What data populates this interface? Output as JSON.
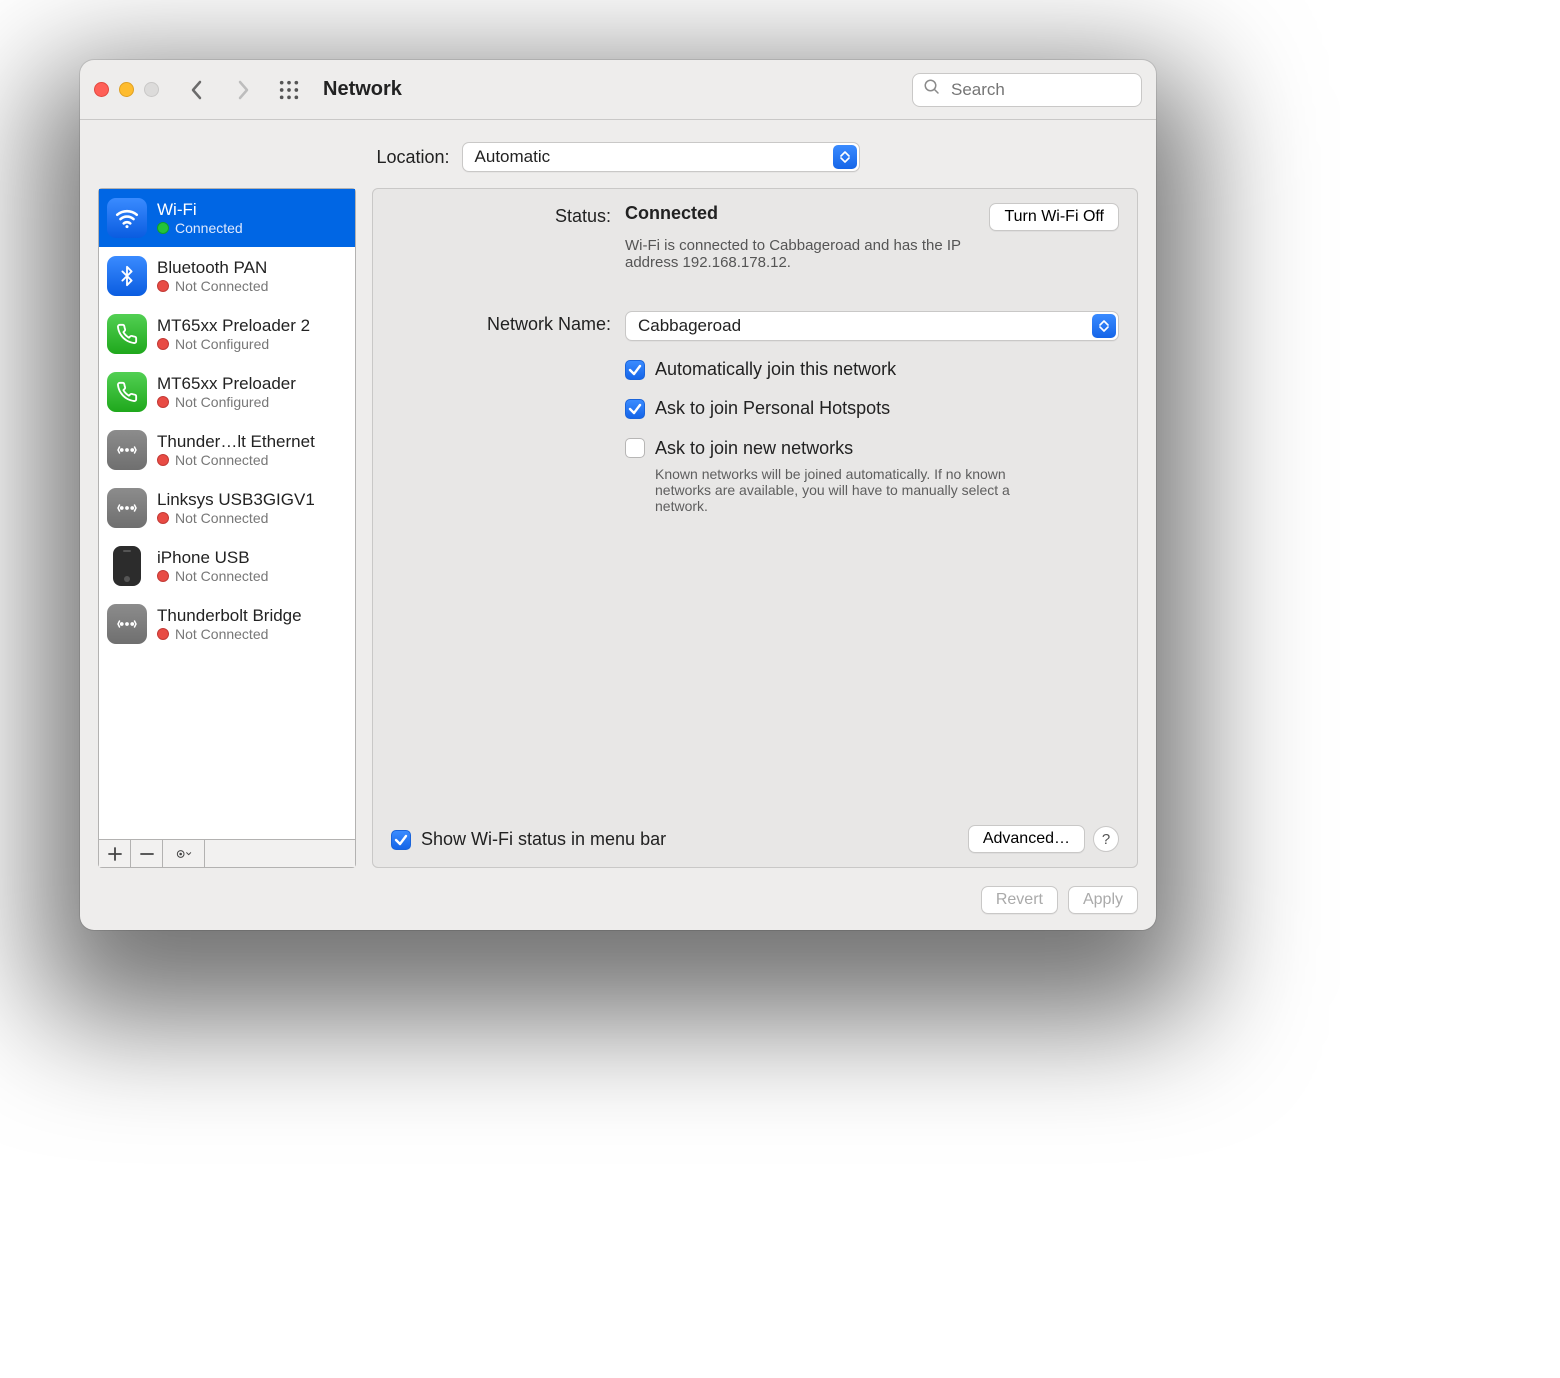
{
  "window": {
    "title": "Network"
  },
  "search": {
    "placeholder": "Search"
  },
  "location": {
    "label": "Location:",
    "value": "Automatic"
  },
  "sidebar": {
    "items": [
      {
        "name": "Wi-Fi",
        "status": "Connected",
        "statusColor": "green",
        "iconType": "wifi",
        "selected": true
      },
      {
        "name": "Bluetooth PAN",
        "status": "Not Connected",
        "statusColor": "red",
        "iconType": "bt"
      },
      {
        "name": "MT65xx Preloader 2",
        "status": "Not Configured",
        "statusColor": "red",
        "iconType": "phone"
      },
      {
        "name": "MT65xx Preloader",
        "status": "Not Configured",
        "statusColor": "red",
        "iconType": "phone"
      },
      {
        "name": "Thunder…lt Ethernet",
        "status": "Not Connected",
        "statusColor": "red",
        "iconType": "eth"
      },
      {
        "name": "Linksys USB3GIGV1",
        "status": "Not Connected",
        "statusColor": "red",
        "iconType": "eth"
      },
      {
        "name": "iPhone USB",
        "status": "Not Connected",
        "statusColor": "red",
        "iconType": "iphone"
      },
      {
        "name": "Thunderbolt Bridge",
        "status": "Not Connected",
        "statusColor": "red",
        "iconType": "eth"
      }
    ]
  },
  "detail": {
    "statusLabel": "Status:",
    "statusValue": "Connected",
    "toggleButton": "Turn Wi-Fi Off",
    "statusDetail": "Wi-Fi is connected to Cabbageroad and has the IP address 192.168.178.12.",
    "networkNameLabel": "Network Name:",
    "networkName": "Cabbageroad",
    "checks": {
      "autojoin": {
        "label": "Automatically join this network",
        "checked": true
      },
      "hotspots": {
        "label": "Ask to join Personal Hotspots",
        "checked": true
      },
      "asknew": {
        "label": "Ask to join new networks",
        "checked": false,
        "help": "Known networks will be joined automatically. If no known networks are available, you will have to manually select a network."
      }
    },
    "menubar": {
      "label": "Show Wi-Fi status in menu bar",
      "checked": true
    },
    "advanced": "Advanced…",
    "help": "?"
  },
  "footer": {
    "revert": "Revert",
    "apply": "Apply"
  }
}
